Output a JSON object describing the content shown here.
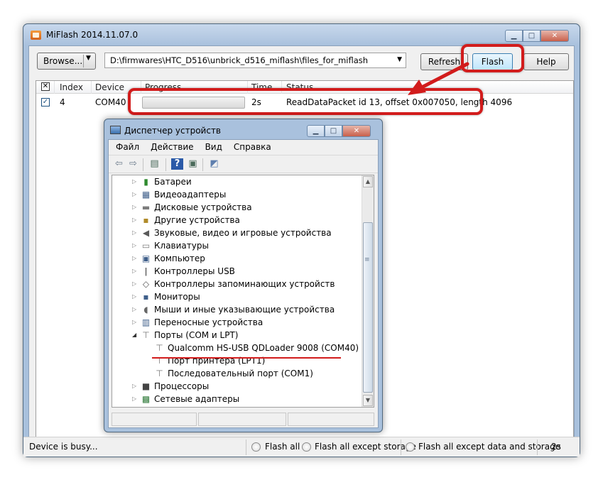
{
  "main": {
    "title": "MiFlash 2014.11.07.0",
    "browse_label": "Browse...",
    "path_value": "D:\\firmwares\\HTC_D516\\unbrick_d516_miflash\\files_for_miflash",
    "refresh_label": "Refresh",
    "flash_label": "Flash",
    "help_label": "Help",
    "columns": [
      "Index",
      "Device",
      "Progress",
      "Time",
      "Status"
    ],
    "rows": [
      {
        "index": "4",
        "device": "COM40",
        "progress_fraction": 0.0,
        "time": "2s",
        "status": "ReadDataPacket id 13, offset 0x007050, length 4096"
      }
    ],
    "status_text": "Device is busy...",
    "radio_options": [
      "Flash all",
      "Flash all except storage",
      "Flash all except data and storage"
    ],
    "status_time": "2s"
  },
  "device_manager": {
    "title": "Диспетчер устройств",
    "menu": [
      "Файл",
      "Действие",
      "Вид",
      "Справка"
    ],
    "tree": [
      {
        "label": "Батареи",
        "icon": "battery-icon",
        "level": 0,
        "expanded": false
      },
      {
        "label": "Видеоадаптеры",
        "icon": "display-adapter-icon",
        "level": 0,
        "expanded": false
      },
      {
        "label": "Дисковые устройства",
        "icon": "disk-icon",
        "level": 0,
        "expanded": false
      },
      {
        "label": "Другие устройства",
        "icon": "other-device-icon",
        "level": 0,
        "expanded": false
      },
      {
        "label": "Звуковые, видео и игровые устройства",
        "icon": "speaker-icon",
        "level": 0,
        "expanded": false
      },
      {
        "label": "Клавиатуры",
        "icon": "keyboard-icon",
        "level": 0,
        "expanded": false
      },
      {
        "label": "Компьютер",
        "icon": "computer-icon",
        "level": 0,
        "expanded": false
      },
      {
        "label": "Контроллеры USB",
        "icon": "usb-icon",
        "level": 0,
        "expanded": false
      },
      {
        "label": "Контроллеры запоминающих устройств",
        "icon": "storage-controller-icon",
        "level": 0,
        "expanded": false
      },
      {
        "label": "Мониторы",
        "icon": "monitor-icon",
        "level": 0,
        "expanded": false
      },
      {
        "label": "Мыши и иные указывающие устройства",
        "icon": "mouse-icon",
        "level": 0,
        "expanded": false
      },
      {
        "label": "Переносные устройства",
        "icon": "portable-device-icon",
        "level": 0,
        "expanded": false
      },
      {
        "label": "Порты (COM и LPT)",
        "icon": "port-icon",
        "level": 0,
        "expanded": true
      },
      {
        "label": "Qualcomm HS-USB QDLoader 9008 (COM40)",
        "icon": "port-icon",
        "level": 1,
        "expanded": false
      },
      {
        "label": "Порт принтера (LPT1)",
        "icon": "port-icon",
        "level": 1,
        "expanded": false
      },
      {
        "label": "Последовательный порт (COM1)",
        "icon": "port-icon",
        "level": 1,
        "expanded": false
      },
      {
        "label": "Процессоры",
        "icon": "processor-icon",
        "level": 0,
        "expanded": false
      },
      {
        "label": "Сетевые адаптеры",
        "icon": "network-adapter-icon",
        "level": 0,
        "expanded": false
      }
    ]
  },
  "colors": {
    "highlight_red": "#d21c1c",
    "title_bar": "#a9c1dd"
  }
}
